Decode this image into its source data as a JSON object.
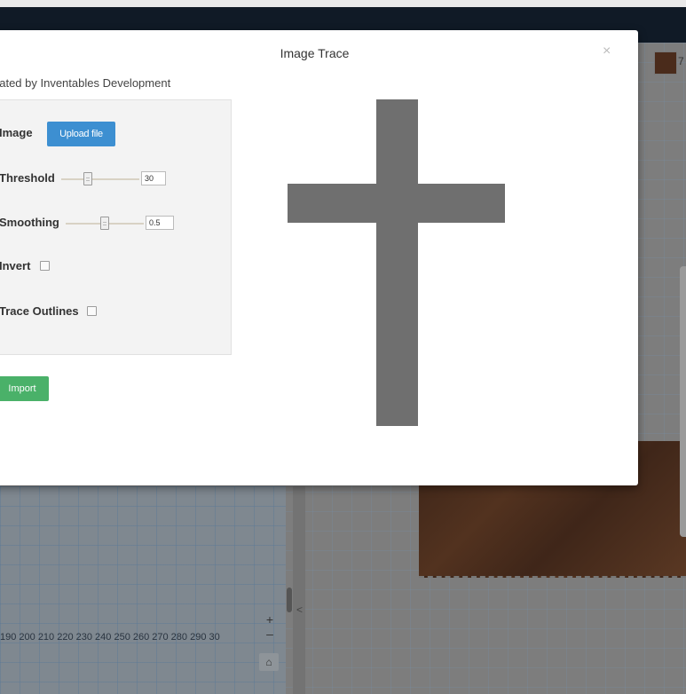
{
  "modal": {
    "title": "Image Trace",
    "close_glyph": "×",
    "author": "eated by Inventables Development"
  },
  "controls": {
    "image_label": "Image",
    "upload_button": "Upload file",
    "threshold_label": "Threshold",
    "threshold_value": "30",
    "smoothing_label": "Smoothing",
    "smoothing_value": "0.5",
    "invert_label": "Invert",
    "invert_checked": false,
    "trace_outlines_label": "Trace Outlines",
    "trace_outlines_checked": false
  },
  "import_button": "Import",
  "preview": {
    "shape": "cross",
    "fill_color": "#6f6f6f"
  },
  "background": {
    "ruler_text": "190 200 210 220 230 240 250 260 270 280 290 30",
    "zoom_in": "+",
    "zoom_out": "–",
    "collapse_glyph": "<",
    "home_icon": "⌂",
    "swatch_label": "7"
  },
  "colors": {
    "upload_button": "#3d8fd1",
    "import_button": "#4ab169",
    "topbar": "#101a26"
  }
}
